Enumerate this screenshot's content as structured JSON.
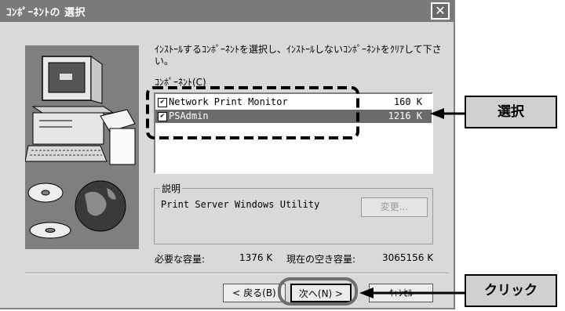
{
  "dialog": {
    "title": "ｺﾝﾎﾟｰﾈﾝﾄの 選択",
    "close_symbol": "✕",
    "instruction": "ｲﾝｽﾄｰﾙするｺﾝﾎﾟｰﾈﾝﾄを選択し、ｲﾝｽﾄｰﾙしないｺﾝﾎﾟｰﾈﾝﾄをｸﾘｱして下さい。",
    "components_label": "ｺﾝﾎﾟｰﾈﾝﾄ(C)",
    "components": [
      {
        "name": "Network Print Monitor",
        "size": "160 K",
        "checked": true,
        "selected": false
      },
      {
        "name": "PSAdmin",
        "size": "1216 K",
        "checked": true,
        "selected": true
      }
    ],
    "description_label": "説明",
    "description_text": "Print Server Windows Utility",
    "change_button": "変更...",
    "required_label": "必要な容量:",
    "required_value": "1376 K",
    "free_label": "現在の空き容量:",
    "free_value": "3065156 K",
    "buttons": {
      "back": "< 戻る(B)",
      "next": "次へ(N) >",
      "cancel": "ｷｬﾝｾﾙ"
    }
  },
  "callouts": {
    "select": "選択",
    "click": "クリック"
  },
  "colors": {
    "titlebar": "#7a7a7a",
    "dialog": "#d9d9d9",
    "selection": "#6b6b6b"
  }
}
